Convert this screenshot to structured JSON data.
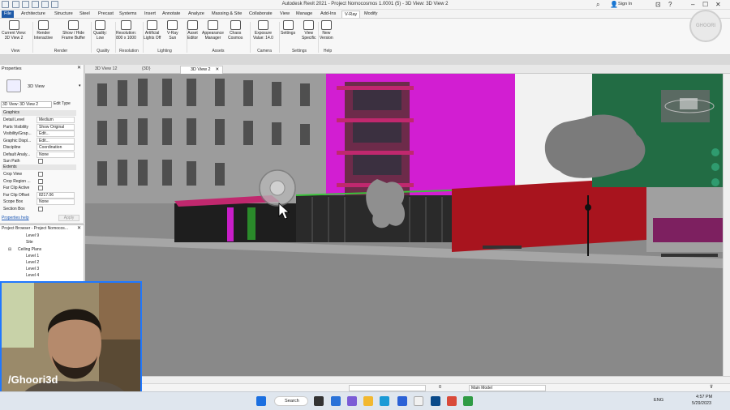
{
  "window": {
    "title": "Autodesk Revit 2021 - Project Nomocosmos 1.0001 (5) - 3D View: 3D View 2",
    "sign_in": "Sign In"
  },
  "tabs": [
    "File",
    "Architecture",
    "Structure",
    "Steel",
    "Precast",
    "Systems",
    "Insert",
    "Annotate",
    "Analyze",
    "Massing & Site",
    "Collaborate",
    "View",
    "Manage",
    "Add-Ins",
    "V-Ray",
    "Modify"
  ],
  "active_tab": "V-Ray",
  "ribbon": {
    "buttons": [
      {
        "label1": "Current View:",
        "label2": "3D View 2",
        "icon": "camera-view-icon"
      },
      {
        "label1": "Render",
        "label2": "Interactive",
        "icon": "render-interactive-icon"
      },
      {
        "label1": "Show / Hide",
        "label2": "Frame Buffer",
        "icon": "frame-buffer-icon"
      },
      {
        "label1": "Quality:",
        "label2": "Low",
        "icon": "quality-icon"
      },
      {
        "label1": "Resolution:",
        "label2": "800 x 1000",
        "icon": "resolution-icon"
      },
      {
        "label1": "Artificial",
        "label2": "Lights Off",
        "icon": "light-bulb-icon"
      },
      {
        "label1": "V-Ray",
        "label2": "Sun",
        "icon": "sun-icon"
      },
      {
        "label1": "Asset",
        "label2": "Editor",
        "icon": "asset-editor-icon"
      },
      {
        "label1": "Appearance",
        "label2": "Manager",
        "icon": "appearance-icon"
      },
      {
        "label1": "Chaos",
        "label2": "Cosmos",
        "icon": "cosmos-icon"
      },
      {
        "label1": "Exposure",
        "label2": "Value: 14.0",
        "icon": "exposure-icon"
      },
      {
        "label1": "Settings",
        "label2": "",
        "icon": "settings-gear-icon"
      },
      {
        "label1": "View",
        "label2": "Specific",
        "icon": "view-specific-icon"
      },
      {
        "label1": "New",
        "label2": "Version",
        "icon": "info-icon"
      }
    ],
    "groups": [
      "View",
      "Render",
      "Quality",
      "Resolution",
      "Lighting",
      "Assets",
      "Camera",
      "Settings",
      "Help"
    ]
  },
  "logo_text": "GHOORI",
  "view_tabs": [
    {
      "label": "3D View 12"
    },
    {
      "label": "{3D}"
    },
    {
      "label": "3D View 2"
    }
  ],
  "properties": {
    "header": "Properties",
    "type_name": "3D View",
    "selector": "3D View: 3D View 2",
    "edit_type": "Edit Type",
    "sections": {
      "graphics": "Graphics",
      "extents": "Extents"
    },
    "graphics_rows": [
      {
        "key": "Detail Level",
        "value": "Medium"
      },
      {
        "key": "Parts Visibility",
        "value": "Show Original"
      },
      {
        "key": "Visibility/Grap...",
        "value": "Edit..."
      },
      {
        "key": "Graphic Displ...",
        "value": "Edit..."
      },
      {
        "key": "Discipline",
        "value": "Coordination"
      },
      {
        "key": "Default Analy...",
        "value": "None"
      },
      {
        "key": "Sun Path",
        "value": ""
      }
    ],
    "extents_rows": [
      {
        "key": "Crop View",
        "value": ""
      },
      {
        "key": "Crop Region ...",
        "value": ""
      },
      {
        "key": "Far Clip Active",
        "value": ""
      },
      {
        "key": "Far Clip Offset",
        "value": "8217.06"
      },
      {
        "key": "Scope Box",
        "value": "None"
      },
      {
        "key": "Section Box",
        "value": ""
      }
    ],
    "help_link": "Properties help",
    "apply": "Apply"
  },
  "project_browser": {
    "header": "Project Browser - Project Nomocos...",
    "items": [
      "Level 9",
      "Site",
      "Ceiling Plans",
      "Level 1",
      "Level 2",
      "Level 3",
      "Level 4"
    ]
  },
  "webcam": {
    "handle": "/Ghoori3d"
  },
  "status": {
    "zero_label": "0",
    "model": "Main Model"
  },
  "taskbar": {
    "search": "Search",
    "lang": "ENG",
    "time": "4:57 PM",
    "date": "5/29/2023"
  }
}
